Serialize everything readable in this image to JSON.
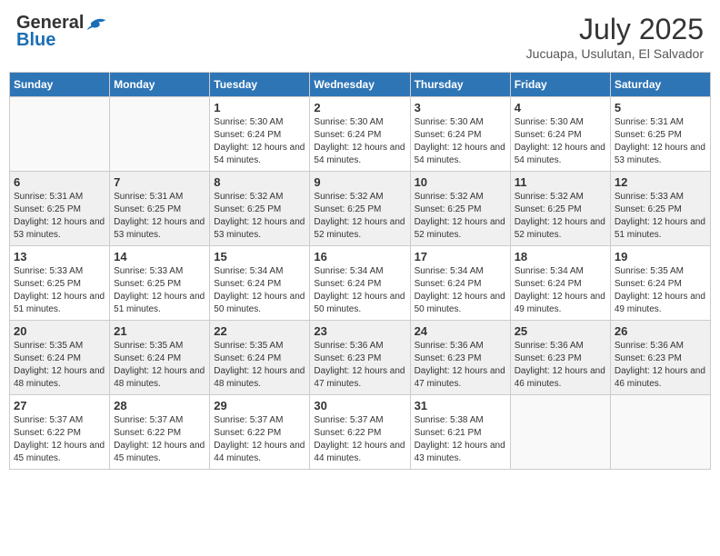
{
  "header": {
    "logo_general": "General",
    "logo_blue": "Blue",
    "month_year": "July 2025",
    "location": "Jucuapa, Usulutan, El Salvador"
  },
  "days_of_week": [
    "Sunday",
    "Monday",
    "Tuesday",
    "Wednesday",
    "Thursday",
    "Friday",
    "Saturday"
  ],
  "weeks": [
    [
      {
        "day": "",
        "info": ""
      },
      {
        "day": "",
        "info": ""
      },
      {
        "day": "1",
        "info": "Sunrise: 5:30 AM\nSunset: 6:24 PM\nDaylight: 12 hours and 54 minutes."
      },
      {
        "day": "2",
        "info": "Sunrise: 5:30 AM\nSunset: 6:24 PM\nDaylight: 12 hours and 54 minutes."
      },
      {
        "day": "3",
        "info": "Sunrise: 5:30 AM\nSunset: 6:24 PM\nDaylight: 12 hours and 54 minutes."
      },
      {
        "day": "4",
        "info": "Sunrise: 5:30 AM\nSunset: 6:24 PM\nDaylight: 12 hours and 54 minutes."
      },
      {
        "day": "5",
        "info": "Sunrise: 5:31 AM\nSunset: 6:25 PM\nDaylight: 12 hours and 53 minutes."
      }
    ],
    [
      {
        "day": "6",
        "info": "Sunrise: 5:31 AM\nSunset: 6:25 PM\nDaylight: 12 hours and 53 minutes."
      },
      {
        "day": "7",
        "info": "Sunrise: 5:31 AM\nSunset: 6:25 PM\nDaylight: 12 hours and 53 minutes."
      },
      {
        "day": "8",
        "info": "Sunrise: 5:32 AM\nSunset: 6:25 PM\nDaylight: 12 hours and 53 minutes."
      },
      {
        "day": "9",
        "info": "Sunrise: 5:32 AM\nSunset: 6:25 PM\nDaylight: 12 hours and 52 minutes."
      },
      {
        "day": "10",
        "info": "Sunrise: 5:32 AM\nSunset: 6:25 PM\nDaylight: 12 hours and 52 minutes."
      },
      {
        "day": "11",
        "info": "Sunrise: 5:32 AM\nSunset: 6:25 PM\nDaylight: 12 hours and 52 minutes."
      },
      {
        "day": "12",
        "info": "Sunrise: 5:33 AM\nSunset: 6:25 PM\nDaylight: 12 hours and 51 minutes."
      }
    ],
    [
      {
        "day": "13",
        "info": "Sunrise: 5:33 AM\nSunset: 6:25 PM\nDaylight: 12 hours and 51 minutes."
      },
      {
        "day": "14",
        "info": "Sunrise: 5:33 AM\nSunset: 6:25 PM\nDaylight: 12 hours and 51 minutes."
      },
      {
        "day": "15",
        "info": "Sunrise: 5:34 AM\nSunset: 6:24 PM\nDaylight: 12 hours and 50 minutes."
      },
      {
        "day": "16",
        "info": "Sunrise: 5:34 AM\nSunset: 6:24 PM\nDaylight: 12 hours and 50 minutes."
      },
      {
        "day": "17",
        "info": "Sunrise: 5:34 AM\nSunset: 6:24 PM\nDaylight: 12 hours and 50 minutes."
      },
      {
        "day": "18",
        "info": "Sunrise: 5:34 AM\nSunset: 6:24 PM\nDaylight: 12 hours and 49 minutes."
      },
      {
        "day": "19",
        "info": "Sunrise: 5:35 AM\nSunset: 6:24 PM\nDaylight: 12 hours and 49 minutes."
      }
    ],
    [
      {
        "day": "20",
        "info": "Sunrise: 5:35 AM\nSunset: 6:24 PM\nDaylight: 12 hours and 48 minutes."
      },
      {
        "day": "21",
        "info": "Sunrise: 5:35 AM\nSunset: 6:24 PM\nDaylight: 12 hours and 48 minutes."
      },
      {
        "day": "22",
        "info": "Sunrise: 5:35 AM\nSunset: 6:24 PM\nDaylight: 12 hours and 48 minutes."
      },
      {
        "day": "23",
        "info": "Sunrise: 5:36 AM\nSunset: 6:23 PM\nDaylight: 12 hours and 47 minutes."
      },
      {
        "day": "24",
        "info": "Sunrise: 5:36 AM\nSunset: 6:23 PM\nDaylight: 12 hours and 47 minutes."
      },
      {
        "day": "25",
        "info": "Sunrise: 5:36 AM\nSunset: 6:23 PM\nDaylight: 12 hours and 46 minutes."
      },
      {
        "day": "26",
        "info": "Sunrise: 5:36 AM\nSunset: 6:23 PM\nDaylight: 12 hours and 46 minutes."
      }
    ],
    [
      {
        "day": "27",
        "info": "Sunrise: 5:37 AM\nSunset: 6:22 PM\nDaylight: 12 hours and 45 minutes."
      },
      {
        "day": "28",
        "info": "Sunrise: 5:37 AM\nSunset: 6:22 PM\nDaylight: 12 hours and 45 minutes."
      },
      {
        "day": "29",
        "info": "Sunrise: 5:37 AM\nSunset: 6:22 PM\nDaylight: 12 hours and 44 minutes."
      },
      {
        "day": "30",
        "info": "Sunrise: 5:37 AM\nSunset: 6:22 PM\nDaylight: 12 hours and 44 minutes."
      },
      {
        "day": "31",
        "info": "Sunrise: 5:38 AM\nSunset: 6:21 PM\nDaylight: 12 hours and 43 minutes."
      },
      {
        "day": "",
        "info": ""
      },
      {
        "day": "",
        "info": ""
      }
    ]
  ]
}
